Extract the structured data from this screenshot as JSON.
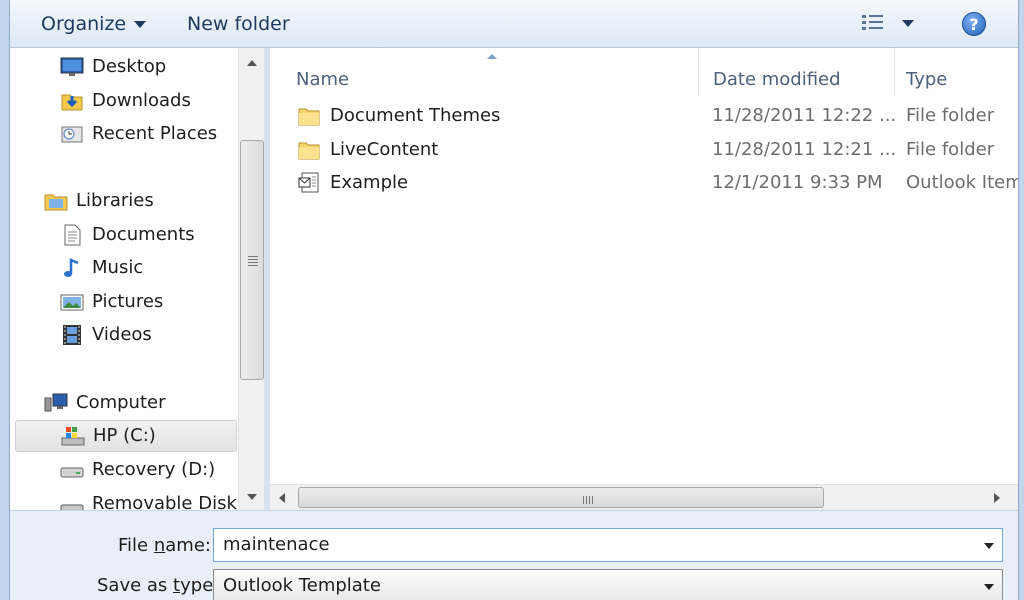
{
  "toolbar": {
    "organize_label": "Organize",
    "new_folder_label": "New folder",
    "help_glyph": "?"
  },
  "nav": {
    "items": [
      {
        "label": "Desktop",
        "icon": "desktop-icon"
      },
      {
        "label": "Downloads",
        "icon": "downloads-icon"
      },
      {
        "label": "Recent Places",
        "icon": "recent-places-icon"
      },
      {
        "label": "Libraries",
        "icon": "libraries-icon"
      },
      {
        "label": "Documents",
        "icon": "documents-icon"
      },
      {
        "label": "Music",
        "icon": "music-icon"
      },
      {
        "label": "Pictures",
        "icon": "pictures-icon"
      },
      {
        "label": "Videos",
        "icon": "videos-icon"
      },
      {
        "label": "Computer",
        "icon": "computer-icon"
      },
      {
        "label": "HP (C:)",
        "icon": "drive-c-icon",
        "selected": true
      },
      {
        "label": "Recovery (D:)",
        "icon": "drive-icon"
      },
      {
        "label": "Removable Disk (",
        "icon": "removable-disk-icon"
      }
    ]
  },
  "filelist": {
    "columns": {
      "name": "Name",
      "date": "Date modified",
      "type": "Type"
    },
    "rows": [
      {
        "name": "Document Themes",
        "date": "11/28/2011 12:22 ...",
        "type": "File folder",
        "icon": "folder-icon"
      },
      {
        "name": "LiveContent",
        "date": "11/28/2011 12:21 ...",
        "type": "File folder",
        "icon": "folder-icon"
      },
      {
        "name": "Example",
        "date": "12/1/2011 9:33 PM",
        "type": "Outlook Item",
        "icon": "outlook-template-icon"
      }
    ]
  },
  "bottom": {
    "file_name_pre": "File ",
    "file_name_u": "n",
    "file_name_post": "ame:",
    "file_name_value": "maintenace",
    "save_type_pre": "Save as ",
    "save_type_u": "t",
    "save_type_post": "ype:",
    "save_type_value": "Outlook Template"
  }
}
